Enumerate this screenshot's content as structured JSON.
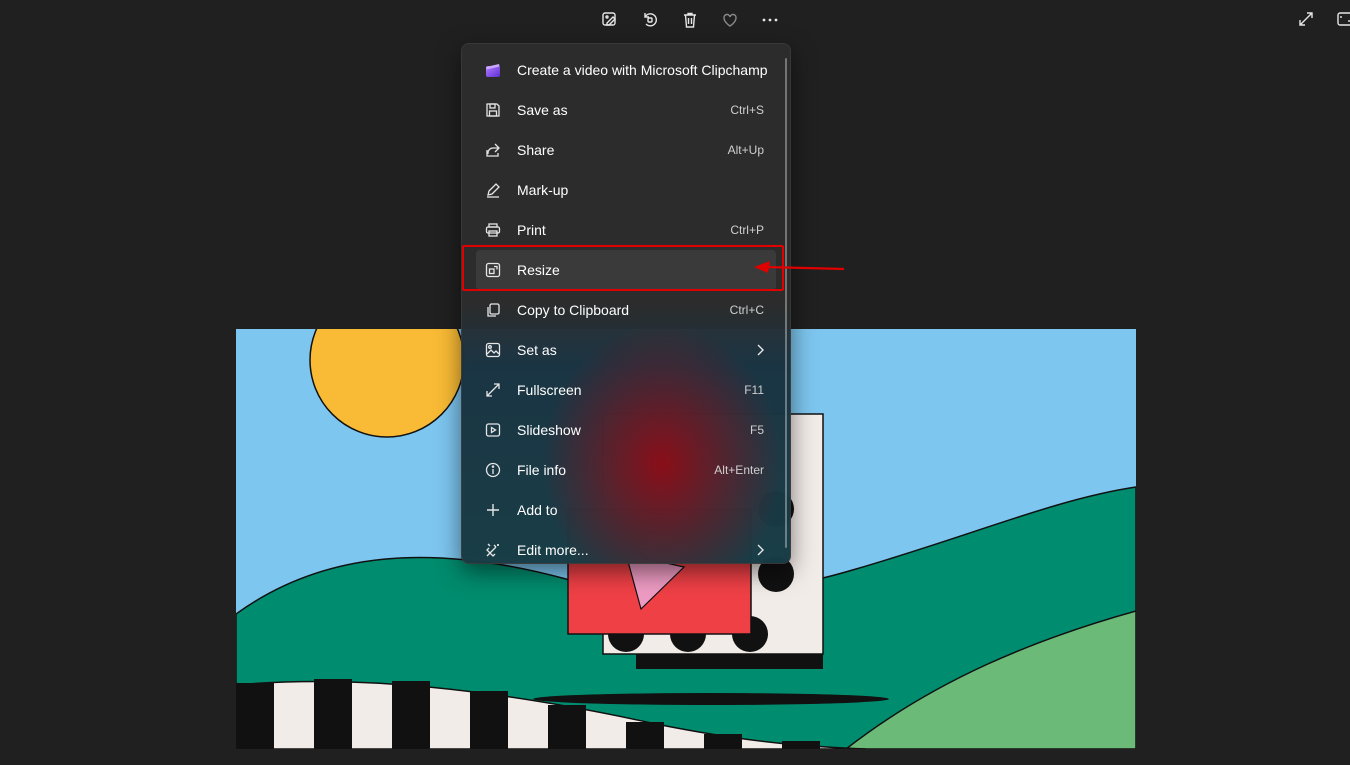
{
  "toolbar": {
    "items": [
      {
        "name": "edit-image",
        "icon": "edit-image-icon"
      },
      {
        "name": "rotate",
        "icon": "rotate-icon"
      },
      {
        "name": "delete",
        "icon": "trash-icon"
      },
      {
        "name": "favorite",
        "icon": "heart-icon"
      },
      {
        "name": "more",
        "icon": "more-icon"
      }
    ]
  },
  "window_controls": {
    "expand": "expand-icon",
    "fit": "fit-window-icon"
  },
  "menu": {
    "items": [
      {
        "label": "Create a video with Microsoft Clipchamp",
        "shortcut": "",
        "icon": "clipchamp-icon"
      },
      {
        "label": "Save as",
        "shortcut": "Ctrl+S",
        "icon": "save-icon"
      },
      {
        "label": "Share",
        "shortcut": "Alt+Up",
        "icon": "share-icon"
      },
      {
        "label": "Mark-up",
        "shortcut": "",
        "icon": "pen-icon"
      },
      {
        "label": "Print",
        "shortcut": "Ctrl+P",
        "icon": "printer-icon"
      },
      {
        "label": "Resize",
        "shortcut": "",
        "icon": "resize-icon"
      },
      {
        "label": "Copy to Clipboard",
        "shortcut": "Ctrl+C",
        "icon": "copy-icon"
      },
      {
        "label": "Set as",
        "shortcut": "",
        "icon": "image-set-icon",
        "submenu": true
      },
      {
        "label": "Fullscreen",
        "shortcut": "F11",
        "icon": "fullscreen-icon"
      },
      {
        "label": "Slideshow",
        "shortcut": "F5",
        "icon": "slideshow-icon"
      },
      {
        "label": "File info",
        "shortcut": "Alt+Enter",
        "icon": "info-icon"
      },
      {
        "label": "Add to",
        "shortcut": "",
        "icon": "plus-icon"
      },
      {
        "label": "Edit more...",
        "shortcut": "",
        "icon": "edit-more-icon",
        "submenu": true
      }
    ]
  },
  "colors": {
    "annotation": "#e00000",
    "sky": "#7dc6ef",
    "sun": "#f9bb35",
    "hill": "#008c6e",
    "light_hill": "#6cba78",
    "block_red": "#ef4046"
  }
}
